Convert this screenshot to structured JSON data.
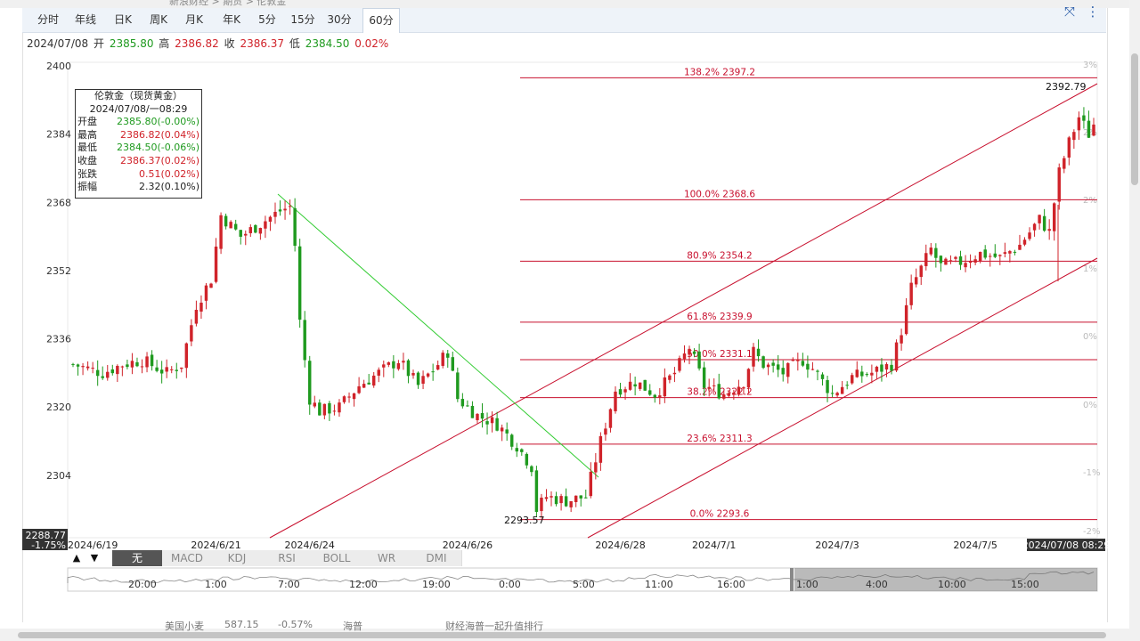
{
  "breadcrumb": "新浪财经 > 期货 > 伦敦金",
  "tabs": [
    {
      "label": "分时"
    },
    {
      "label": "年线"
    },
    {
      "label": "日K"
    },
    {
      "label": "周K"
    },
    {
      "label": "月K"
    },
    {
      "label": "年K"
    },
    {
      "label": "5分"
    },
    {
      "label": "15分"
    },
    {
      "label": "30分"
    },
    {
      "label": "60分",
      "active": true
    }
  ],
  "ohlc": {
    "date": "2024/07/08",
    "open_label": "开",
    "open": "2385.80",
    "high_label": "高",
    "high": "2386.82",
    "close_label": "收",
    "close": "2386.37",
    "low_label": "低",
    "low": "2384.50",
    "change": "0.02%"
  },
  "infobox": {
    "title": "伦敦金（现货黄金）",
    "datetime": "2024/07/08/一08:29",
    "rows": [
      {
        "k": "开盘",
        "v": "2385.80(-0.00%)",
        "color": "#1f9a1f"
      },
      {
        "k": "最高",
        "v": "2386.82(0.04%)",
        "color": "#d0232a"
      },
      {
        "k": "最低",
        "v": "2384.50(-0.06%)",
        "color": "#1f9a1f"
      },
      {
        "k": "收盘",
        "v": "2386.37(0.02%)",
        "color": "#d0232a"
      },
      {
        "k": "张跌",
        "v": "0.51(0.02%)",
        "color": "#d0232a"
      },
      {
        "k": "振幅",
        "v": "2.32(0.10%)",
        "color": "#222222"
      }
    ]
  },
  "indicators": [
    {
      "label": "无",
      "active": true
    },
    {
      "label": "MACD"
    },
    {
      "label": "KDJ"
    },
    {
      "label": "RSI"
    },
    {
      "label": "BOLL"
    },
    {
      "label": "WR"
    },
    {
      "label": "DMI"
    }
  ],
  "navigator": {
    "labels": [
      "20:00",
      "1:00",
      "7:00",
      "12:00",
      "19:00",
      "0:00",
      "5:00",
      "11:00",
      "16:00",
      "1:00",
      "4:00",
      "10:00",
      "15:00"
    ]
  },
  "cursor_readout": {
    "price": "2288.77",
    "pct": "-1.75%",
    "time": "2024/07/08 08:29"
  },
  "bottom_text": [
    "美国小麦",
    "587.15",
    "-0.57%",
    "海普",
    "财经海普一起升值排行"
  ],
  "colors": {
    "up": "#d0232a",
    "down": "#1f9a1f",
    "fib": "#c8102e",
    "trend_down": "#33cc33"
  },
  "chart_data": {
    "type": "candlestick",
    "symbol": "伦敦金",
    "interval": "60分",
    "ylim": [
      2288.77,
      2401
    ],
    "y_ticks": [
      2400,
      2384,
      2368,
      2352,
      2336,
      2320,
      2304
    ],
    "pct_ticks": [
      "3%",
      "2%",
      "2%",
      "1%",
      "0%",
      "0%",
      "-1%",
      "-2%"
    ],
    "x_ticks": [
      "2024/6/19",
      "2024/6/21",
      "2024/6/24",
      "2024/6/26",
      "2024/6/28",
      "2024/7/1",
      "2024/7/3",
      "2024/7/5"
    ],
    "close_path": [
      [
        0,
        2330
      ],
      [
        6,
        2328
      ],
      [
        10,
        2330
      ],
      [
        14,
        2331
      ],
      [
        19,
        2328
      ],
      [
        22,
        2330
      ],
      [
        25,
        2344
      ],
      [
        28,
        2350
      ],
      [
        30,
        2365
      ],
      [
        34,
        2360
      ],
      [
        38,
        2363
      ],
      [
        42,
        2366
      ],
      [
        44,
        2367
      ],
      [
        45,
        2358
      ],
      [
        46,
        2340
      ],
      [
        48,
        2322
      ],
      [
        50,
        2319
      ],
      [
        54,
        2320
      ],
      [
        58,
        2325
      ],
      [
        62,
        2328
      ],
      [
        66,
        2331
      ],
      [
        70,
        2325
      ],
      [
        74,
        2330
      ],
      [
        76,
        2333
      ],
      [
        78,
        2322
      ],
      [
        82,
        2318
      ],
      [
        86,
        2316
      ],
      [
        90,
        2311
      ],
      [
        93,
        2306
      ],
      [
        94,
        2296
      ],
      [
        96,
        2299
      ],
      [
        100,
        2298
      ],
      [
        104,
        2299
      ],
      [
        107,
        2312
      ],
      [
        110,
        2324
      ],
      [
        114,
        2326
      ],
      [
        118,
        2323
      ],
      [
        122,
        2328
      ],
      [
        125,
        2334
      ],
      [
        128,
        2325
      ],
      [
        132,
        2323
      ],
      [
        136,
        2326
      ],
      [
        138,
        2333
      ],
      [
        140,
        2330
      ],
      [
        144,
        2328
      ],
      [
        148,
        2331
      ],
      [
        150,
        2329
      ],
      [
        154,
        2323
      ],
      [
        158,
        2327
      ],
      [
        162,
        2328
      ],
      [
        166,
        2330
      ],
      [
        168,
        2338
      ],
      [
        170,
        2348
      ],
      [
        174,
        2357
      ],
      [
        176,
        2353
      ],
      [
        180,
        2354
      ],
      [
        184,
        2356
      ],
      [
        188,
        2355
      ],
      [
        192,
        2358
      ],
      [
        196,
        2364
      ],
      [
        198,
        2361
      ],
      [
        200,
        2375
      ],
      [
        202,
        2382
      ],
      [
        204,
        2388
      ],
      [
        206,
        2384
      ],
      [
        207,
        2386.37
      ]
    ],
    "annotations": {
      "high": 2392.79,
      "low": 2293.57
    },
    "fibonacci": [
      {
        "label": "138.2%",
        "value": 2397.2
      },
      {
        "label": "100.0%",
        "value": 2368.6
      },
      {
        "label": "80.9%",
        "value": 2354.2
      },
      {
        "label": "61.8%",
        "value": 2339.9
      },
      {
        "label": "50.0%",
        "value": 2331.1
      },
      {
        "label": "38.2%",
        "value": 2322.2
      },
      {
        "label": "23.6%",
        "value": 2311.3
      },
      {
        "label": "0.0%",
        "value": 2293.6
      }
    ]
  }
}
